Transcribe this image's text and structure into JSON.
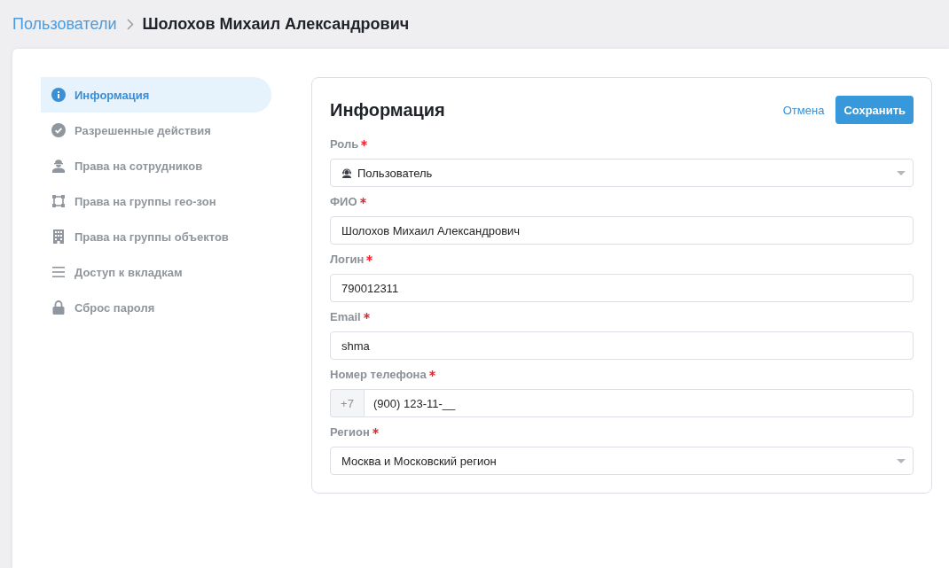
{
  "breadcrumb": {
    "parent": "Пользователи",
    "current": "Шолохов Михаил Александрович"
  },
  "sidebar": {
    "items": [
      {
        "label": "Информация",
        "selected": true
      },
      {
        "label": "Разрешенные действия",
        "selected": false
      },
      {
        "label": "Права на сотрудников",
        "selected": false
      },
      {
        "label": "Права на группы гео-зон",
        "selected": false
      },
      {
        "label": "Права на группы объектов",
        "selected": false
      },
      {
        "label": "Доступ к вкладкам",
        "selected": false
      },
      {
        "label": "Сброс пароля",
        "selected": false
      }
    ]
  },
  "form": {
    "title": "Информация",
    "cancel": "Отмена",
    "save": "Сохранить",
    "fields": [
      {
        "label": "Роль",
        "required": true,
        "kind": "role",
        "value": "Пользователь"
      },
      {
        "label": "ФИО",
        "required": true,
        "kind": "text",
        "value": "Шолохов Михаил Александрович"
      },
      {
        "label": "Логин",
        "required": true,
        "kind": "text",
        "value": "790012311"
      },
      {
        "label": "Email",
        "required": true,
        "kind": "text",
        "value": "shma"
      },
      {
        "label": "Номер телефона",
        "required": true,
        "kind": "phone",
        "prefix": "+7",
        "value": "(900) 123-11-__"
      },
      {
        "label": "Регион",
        "required": true,
        "kind": "select",
        "value": "Москва и Московский регион"
      }
    ]
  }
}
